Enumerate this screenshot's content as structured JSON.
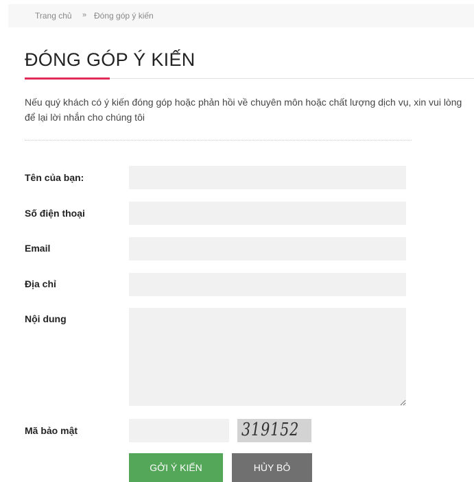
{
  "breadcrumb": {
    "home": "Trang chủ",
    "separator": "»",
    "current": "Đóng góp ý kiến"
  },
  "page": {
    "title": "ĐÓNG GÓP Ý KIẾN",
    "intro": "Nếu quý khách có ý kiến đóng góp hoặc phản hồi về chuyên môn hoặc chất lượng dịch vụ, xin vui lòng để lại lời nhắn cho chúng tôi",
    "accent_color": "#e32b59"
  },
  "form": {
    "name_label": "Tên của bạn:",
    "phone_label": "Số điện thoại",
    "email_label": "Email",
    "address_label": "Địa chỉ",
    "content_label": "Nội dung",
    "captcha_label": "Mã bảo mật",
    "captcha_code": "319152",
    "name_value": "",
    "phone_value": "",
    "email_value": "",
    "address_value": "",
    "content_value": "",
    "captcha_value": ""
  },
  "buttons": {
    "submit": "GỞI Ý KIẾN",
    "cancel": "HỦY BỎ",
    "submit_color": "#54a759",
    "cancel_color": "#707070"
  }
}
